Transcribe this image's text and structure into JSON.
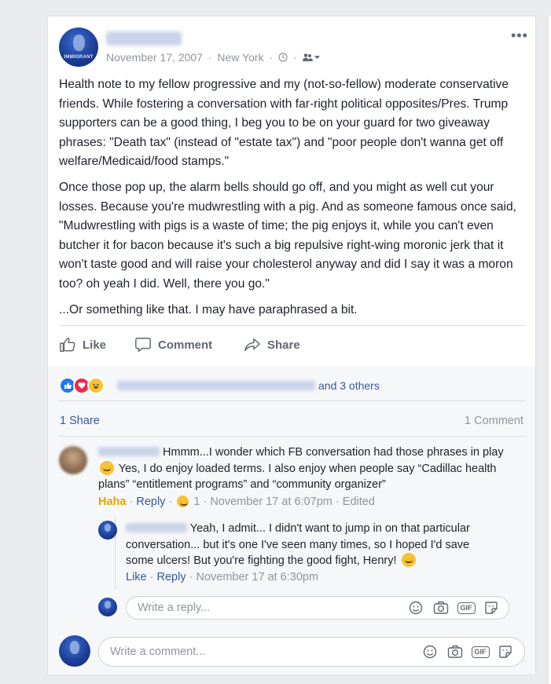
{
  "post": {
    "date": "November 17, 2007",
    "location": "New York",
    "separator": "·",
    "avatar_watermark": "IMMIGRANT",
    "paragraphs": [
      "Health note to my fellow progressive and my (not-so-fellow) moderate conservative friends. While fostering a conversation with far-right political opposites/Pres. Trump supporters can be a good thing, I beg you to be on your guard for two giveaway phrases: \"Death tax\" (instead of \"estate tax\") and \"poor people don't wanna get off welfare/Medicaid/food stamps.\"",
      "Once those pop up, the alarm bells should go off, and you might as well cut your losses. Because you're mudwrestling with a pig. And as someone famous once said, \"Mudwrestling with pigs is a waste of time; the pig enjoys it, while you can't even butcher it for bacon because it's such a big repulsive right-wing moronic jerk that it won't taste good and will raise your cholesterol anyway and did I say it was a moron too? oh yeah I did. Well, there you go.\"",
      "...Or something like that. I may have paraphrased a bit."
    ]
  },
  "actions": {
    "like": "Like",
    "comment": "Comment",
    "share": "Share"
  },
  "reactions": {
    "others": "and 3 others"
  },
  "counts": {
    "shares": "1 Share",
    "comments": "1 Comment"
  },
  "comment1": {
    "text_a": "Hmmm...I wonder which FB conversation had those phrases in play",
    "text_b": "Yes, I do enjoy loaded terms. I also enjoy when people say “Cadillac health plans” “entitlement programs” and “community organizer”",
    "haha": "Haha",
    "reply": "Reply",
    "react_count": "1",
    "time": "November 17 at 6:07pm",
    "edited": "Edited"
  },
  "reply1": {
    "text": "Yeah, I admit... I didn't want to jump in on that particular conversation... but it's one I've seen many times, so I hoped I'd save some ulcers! But you're fighting the good fight, Henry!",
    "like": "Like",
    "reply": "Reply",
    "time": "November 17 at 6:30pm"
  },
  "reply_input": {
    "placeholder": "Write a reply..."
  },
  "comment_input": {
    "placeholder": "Write a comment..."
  },
  "input_buttons": {
    "gif": "GIF"
  },
  "colors": {
    "link": "#385898",
    "muted": "#90949c",
    "haha": "#e1a700",
    "like_blue": "#2078f4",
    "love_red": "#f0284a"
  }
}
